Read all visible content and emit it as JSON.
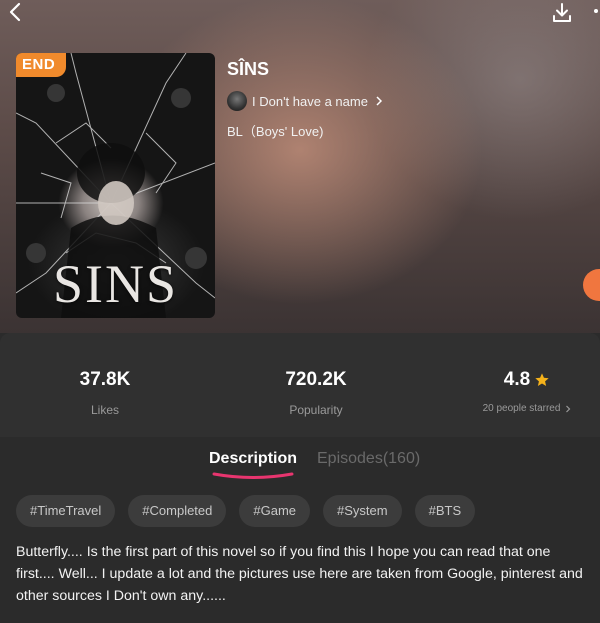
{
  "header": {
    "back_icon": "chevron-left-icon",
    "download_icon": "download-icon",
    "more_icon": "more-vertical-icon"
  },
  "book": {
    "badge": "END",
    "cover_title": "SINS",
    "title": "SÎNS",
    "author": "I Don't have a name",
    "genre": "BL（Boys' Love)"
  },
  "stats": {
    "likes_value": "37.8K",
    "likes_label": "Likes",
    "popularity_value": "720.2K",
    "popularity_label": "Popularity",
    "rating_value": "4.8",
    "starred_label": "20 people starred",
    "star_color": "#f5b21b"
  },
  "tabs": {
    "description": "Description",
    "episodes": "Episodes(160)",
    "accent": "#e8356f"
  },
  "tags": [
    "#TimeTravel",
    "#Completed",
    "#Game",
    "#System",
    "#BTS"
  ],
  "description": "Butterfly.... Is the first part of this novel so if you find this I hope you can read that one first.... Well... I update a lot and the pictures use here are taken from Google, pinterest and other sources I Don't own any......",
  "colors": {
    "background": "#2b2b2b",
    "badge": "#f08a2c",
    "side_bubble": "#f0763f"
  }
}
